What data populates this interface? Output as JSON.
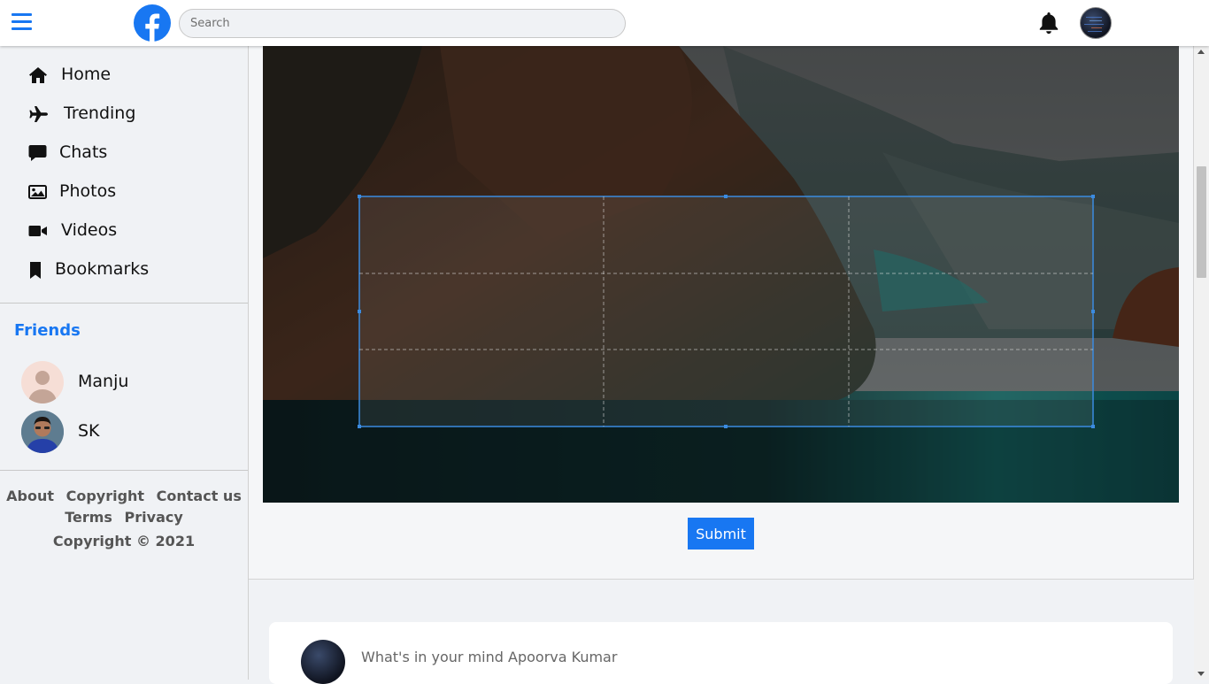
{
  "header": {
    "search_placeholder": "Search",
    "brand_color": "#1877f2"
  },
  "sidebar": {
    "items": [
      {
        "label": "Home",
        "icon": "home-icon"
      },
      {
        "label": "Trending",
        "icon": "airplane-icon"
      },
      {
        "label": "Chats",
        "icon": "chat-bubble-icon"
      },
      {
        "label": "Photos",
        "icon": "image-icon"
      },
      {
        "label": "Videos",
        "icon": "video-camera-icon"
      },
      {
        "label": "Bookmarks",
        "icon": "bookmark-icon"
      }
    ],
    "friends_title": "Friends",
    "friends": [
      {
        "name": "Manju"
      },
      {
        "name": "SK"
      }
    ],
    "footer_links": [
      "About",
      "Copyright",
      "Contact us",
      "Terms",
      "Privacy"
    ],
    "copyright": "Copyright © 2021"
  },
  "crop": {
    "submit_label": "Submit"
  },
  "post": {
    "placeholder": "What's in your mind Apoorva Kumar"
  }
}
